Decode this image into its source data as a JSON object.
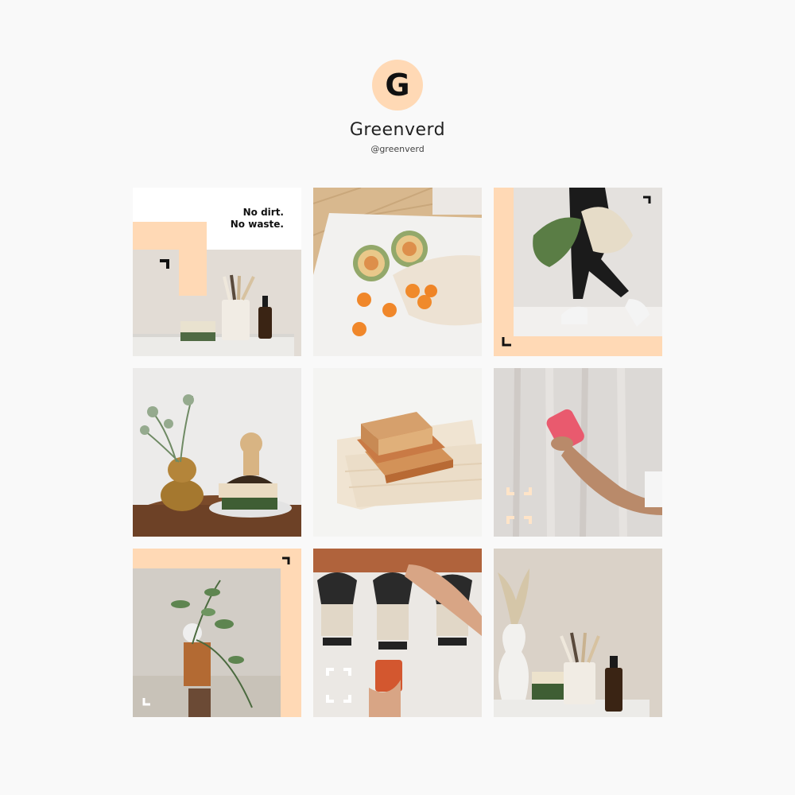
{
  "profile": {
    "avatar_letter": "G",
    "name": "Greenverd",
    "handle": "@greenverd",
    "accent_color": "#ffd9b5"
  },
  "posts": [
    {
      "caption_line1": "No dirt.",
      "caption_line2": "No waste.",
      "subject": "bathroom-set"
    },
    {
      "subject": "melons-and-apricots-mesh-bag"
    },
    {
      "subject": "person-with-mesh-bag"
    },
    {
      "subject": "vase-and-brush-with-soap"
    },
    {
      "subject": "stacked-soaps-on-cloth"
    },
    {
      "subject": "hand-holding-pink-cup"
    },
    {
      "subject": "eucalyptus-on-stones"
    },
    {
      "subject": "bulk-food-dispensers"
    },
    {
      "subject": "bathroom-set-with-brushes"
    }
  ]
}
